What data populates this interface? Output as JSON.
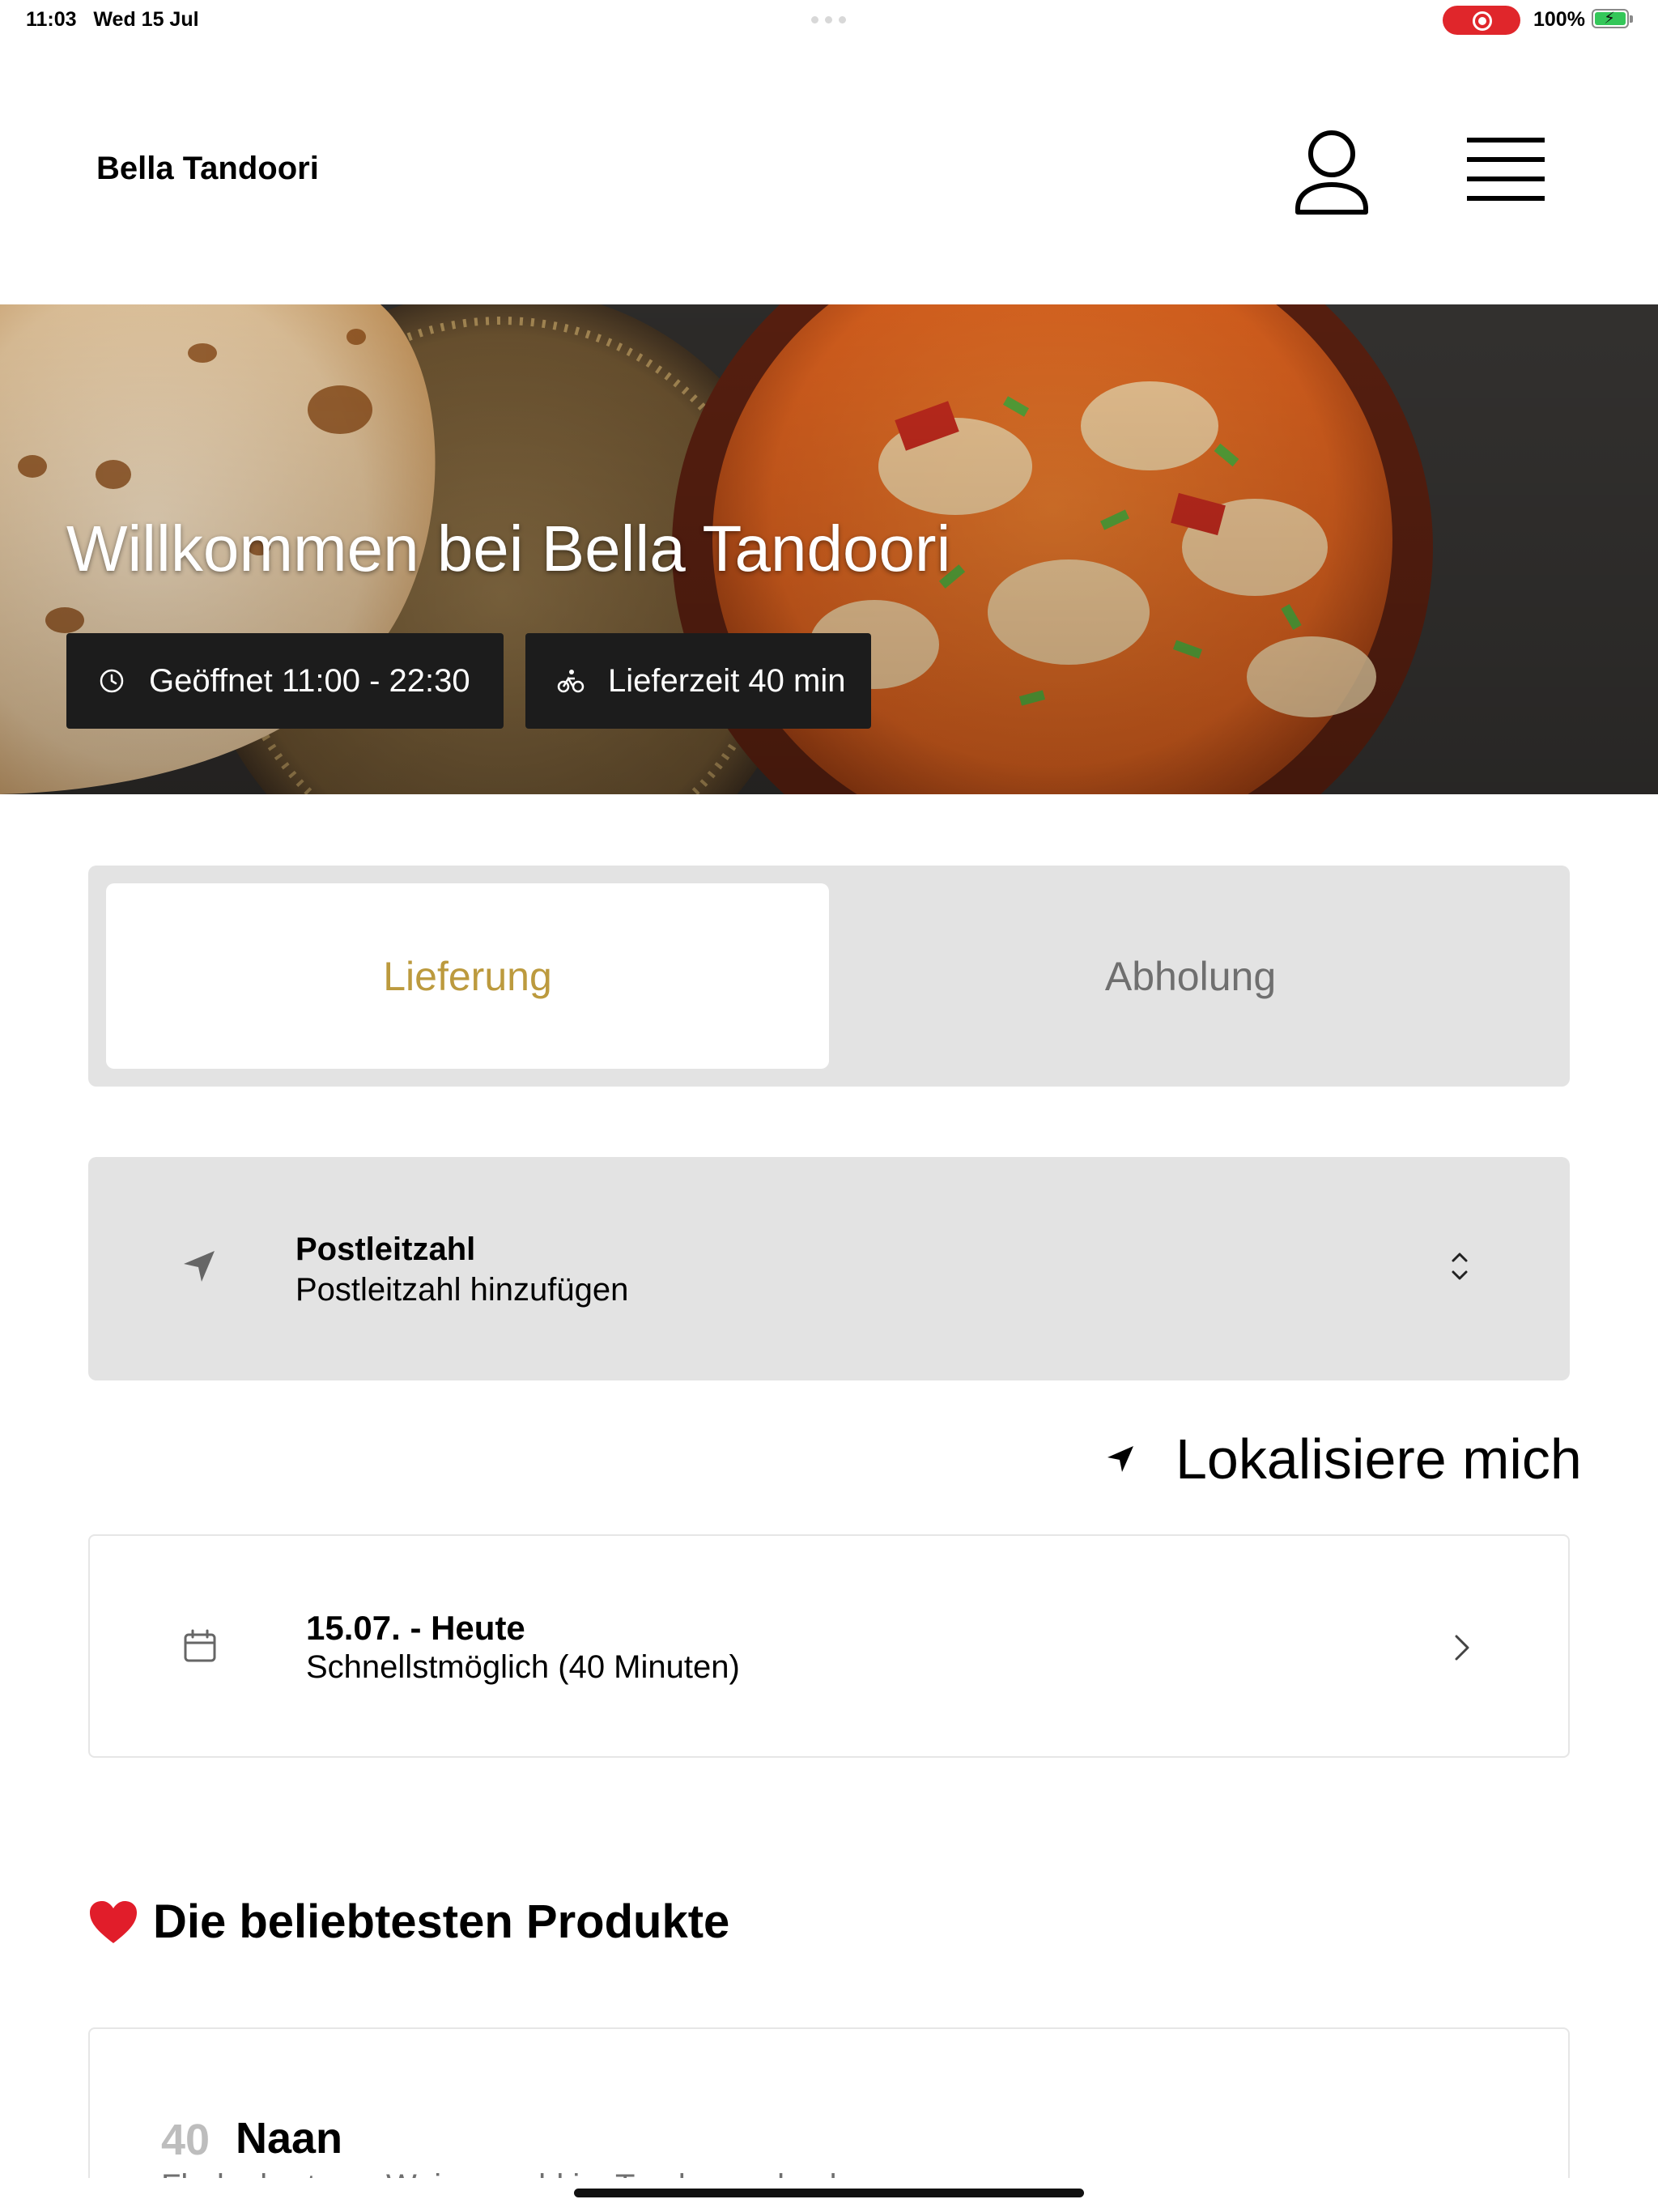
{
  "status_bar": {
    "time": "11:03",
    "date": "Wed 15 Jul",
    "battery": "100%"
  },
  "header": {
    "brand": "Bella Tandoori",
    "user_icon": "person-icon",
    "menu_icon": "hamburger-menu-icon"
  },
  "hero": {
    "title": "Willkommen bei Bella Tandoori",
    "opening_hours": "Geöffnet 11:00 - 22:30",
    "delivery_time": "Lieferzeit 40 min",
    "opening_icon": "clock-icon",
    "delivery_icon": "bicycle-icon"
  },
  "order_mode": {
    "tabs": [
      {
        "label": "Lieferung",
        "active": true
      },
      {
        "label": "Abholung",
        "active": false
      }
    ],
    "accent_color": "#bc9a3e"
  },
  "postcode": {
    "label": "Postleitzahl",
    "value": "Postleitzahl hinzufügen",
    "icon": "location-arrow-icon"
  },
  "locate_me": {
    "label": "Lokalisiere mich",
    "icon": "location-arrow-icon"
  },
  "delivery_time_slot": {
    "date": "15.07. - Heute",
    "time": "Schnellstmöglich (40 Minuten)",
    "icon": "calendar-icon"
  },
  "popular": {
    "title": "Die beliebtesten Produkte",
    "icon": "heart-icon",
    "products": [
      {
        "number": "40",
        "name": "Naan",
        "description": "Fladenbrot aus Weizenmehl im Tandoor gebacken"
      }
    ]
  }
}
